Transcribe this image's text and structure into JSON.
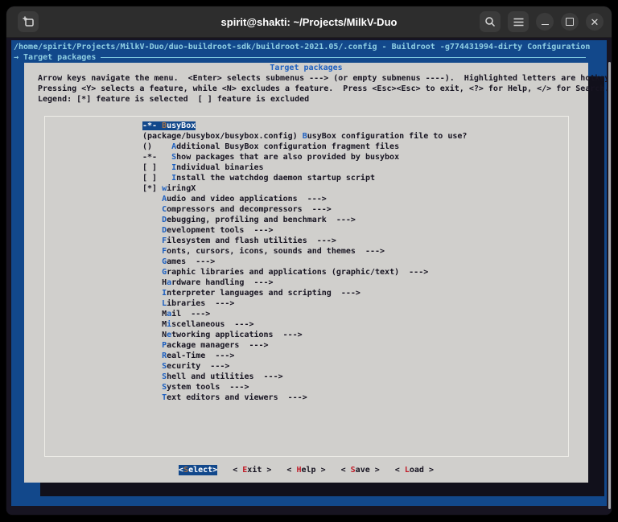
{
  "window": {
    "title": "spirit@shakti: ~/Projects/MilkV-Duo"
  },
  "titlebar": {
    "icons": {
      "new_tab": "+",
      "search": "⌕",
      "menu": "☰",
      "close": "✕"
    }
  },
  "screen": {
    "path_line": "/home/spirit/Projects/MilkV-Duo/duo-buildroot-sdk/buildroot-2021.05/.config - Buildroot -g774431994-dirty Configuration",
    "breadcrumb": "→ Target packages"
  },
  "dialog": {
    "title": "Target packages",
    "instructions": [
      "Arrow keys navigate the menu.  <Enter> selects submenus ---> (or empty submenus ----).  Highlighted letters are hotkeys.",
      "Pressing <Y> selects a feature, while <N> excludes a feature.  Press <Esc><Esc> to exit, <?> for Help, </> for Search.",
      "Legend: [*] feature is selected  [ ] feature is excluded"
    ],
    "menu": {
      "items": [
        {
          "pre": "-*- ",
          "key": "B",
          "post": "usyBox",
          "selected": true
        },
        {
          "pre": "(package/busybox/busybox.config) ",
          "key": "B",
          "post": "usyBox configuration file to use?"
        },
        {
          "pre": "()    ",
          "key": "A",
          "post": "dditional BusyBox configuration fragment files"
        },
        {
          "pre": "-*-   ",
          "key": "S",
          "post": "how packages that are also provided by busybox"
        },
        {
          "pre": "[ ]   ",
          "key": "I",
          "post": "ndividual binaries"
        },
        {
          "pre": "[ ]   ",
          "key": "I",
          "post": "nstall the watchdog daemon startup script"
        },
        {
          "pre": "[*] ",
          "key": "w",
          "post": "iringX"
        },
        {
          "pre": "    ",
          "key": "A",
          "post": "udio and video applications  --->"
        },
        {
          "pre": "    ",
          "key": "C",
          "post": "ompressors and decompressors  --->"
        },
        {
          "pre": "    ",
          "key": "D",
          "post": "ebugging, profiling and benchmark  --->"
        },
        {
          "pre": "    ",
          "key": "D",
          "post": "evelopment tools  --->"
        },
        {
          "pre": "    ",
          "key": "F",
          "post": "ilesystem and flash utilities  --->"
        },
        {
          "pre": "    ",
          "key": "F",
          "post": "onts, cursors, icons, sounds and themes  --->"
        },
        {
          "pre": "    ",
          "key": "G",
          "post": "ames  --->"
        },
        {
          "pre": "    ",
          "key": "G",
          "post": "raphic libraries and applications (graphic/text)  --->"
        },
        {
          "pre": "    H",
          "key": "a",
          "post": "rdware handling  --->"
        },
        {
          "pre": "    ",
          "key": "I",
          "post": "nterpreter languages and scripting  --->"
        },
        {
          "pre": "    ",
          "key": "L",
          "post": "ibraries  --->"
        },
        {
          "pre": "    M",
          "key": "a",
          "post": "il  --->"
        },
        {
          "pre": "    M",
          "key": "i",
          "post": "scellaneous  --->"
        },
        {
          "pre": "    N",
          "key": "e",
          "post": "tworking applications  --->"
        },
        {
          "pre": "    ",
          "key": "P",
          "post": "ackage managers  --->"
        },
        {
          "pre": "    ",
          "key": "R",
          "post": "eal-Time  --->"
        },
        {
          "pre": "    ",
          "key": "S",
          "post": "ecurity  --->"
        },
        {
          "pre": "    ",
          "key": "S",
          "post": "hell and utilities  --->"
        },
        {
          "pre": "    ",
          "key": "S",
          "post": "ystem tools  --->"
        },
        {
          "pre": "    ",
          "key": "T",
          "post": "ext editors and viewers  --->"
        }
      ]
    },
    "buttons": [
      {
        "pre": "<",
        "key": "S",
        "post": "elect>",
        "active": true
      },
      {
        "pre": "< ",
        "key": "E",
        "post": "xit >"
      },
      {
        "pre": "< ",
        "key": "H",
        "post": "elp >"
      },
      {
        "pre": "< ",
        "key": "S",
        "post": "ave >"
      },
      {
        "pre": "< ",
        "key": "L",
        "post": "oad >"
      }
    ]
  },
  "colors": {
    "screen_blue": "#12488B",
    "dialog_bg": "#D0CFCC",
    "hotkey_blue": "#1d5fbf",
    "hotkey_red": "#C01C28",
    "selected_hotkey_yellow": "#A2734C",
    "title_blue": "#1d5fbf",
    "screen_text_cyan": "#8fcfe3",
    "shadow": "#11101b",
    "titlebar_bg": "#2d2d2d"
  }
}
